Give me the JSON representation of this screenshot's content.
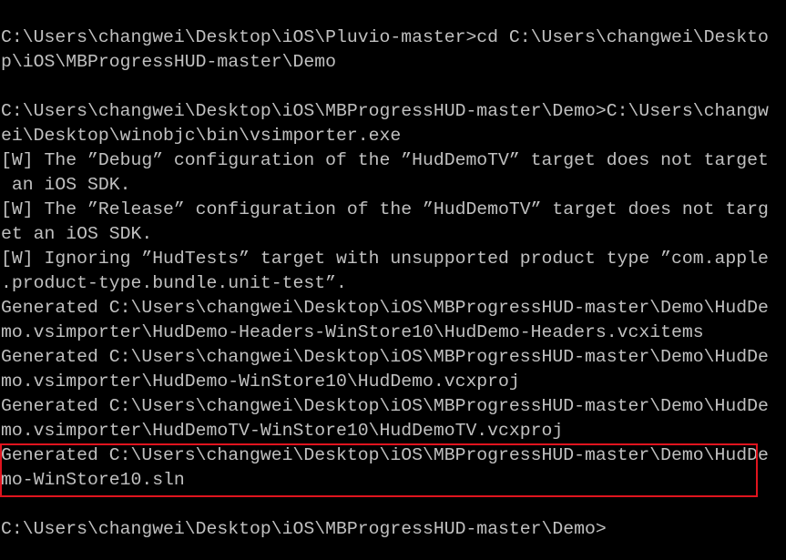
{
  "console": {
    "lines": [
      "C:\\Users\\changwei\\Desktop\\iOS\\Pluvio-master>cd C:\\Users\\changwei\\Deskto",
      "p\\iOS\\MBProgressHUD-master\\Demo",
      "",
      "C:\\Users\\changwei\\Desktop\\iOS\\MBProgressHUD-master\\Demo>C:\\Users\\changw",
      "ei\\Desktop\\winobjc\\bin\\vsimporter.exe",
      "[W] The ”Debug” configuration of the ”HudDemoTV” target does not target",
      " an iOS SDK.",
      "[W] The ”Release” configuration of the ”HudDemoTV” target does not targ",
      "et an iOS SDK.",
      "[W] Ignoring ”HudTests” target with unsupported product type ”com.apple",
      ".product-type.bundle.unit-test”.",
      "Generated C:\\Users\\changwei\\Desktop\\iOS\\MBProgressHUD-master\\Demo\\HudDe",
      "mo.vsimporter\\HudDemo-Headers-WinStore10\\HudDemo-Headers.vcxitems",
      "Generated C:\\Users\\changwei\\Desktop\\iOS\\MBProgressHUD-master\\Demo\\HudDe",
      "mo.vsimporter\\HudDemo-WinStore10\\HudDemo.vcxproj",
      "Generated C:\\Users\\changwei\\Desktop\\iOS\\MBProgressHUD-master\\Demo\\HudDe",
      "mo.vsimporter\\HudDemoTV-WinStore10\\HudDemoTV.vcxproj",
      "Generated C:\\Users\\changwei\\Desktop\\iOS\\MBProgressHUD-master\\Demo\\HudDe",
      "mo-WinStore10.sln",
      "",
      "C:\\Users\\changwei\\Desktop\\iOS\\MBProgressHUD-master\\Demo>"
    ]
  },
  "colors": {
    "background": "#000000",
    "text": "#c0c0c0",
    "highlight_box": "#e0141e"
  }
}
